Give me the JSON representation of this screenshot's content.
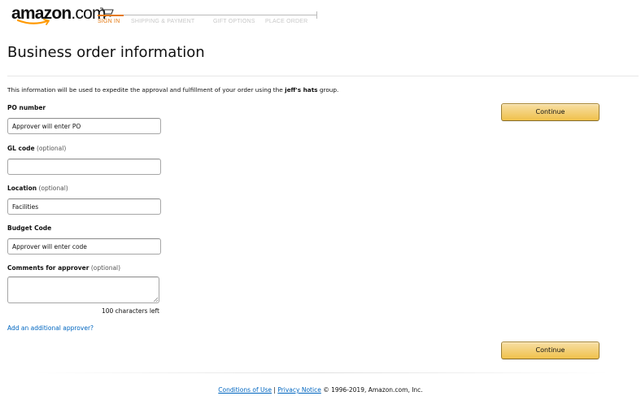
{
  "header": {
    "logo_main": "amazon",
    "logo_suffix": ".com",
    "steps": [
      "SIGN IN",
      "SHIPPING & PAYMENT",
      "GIFT OPTIONS",
      "PLACE ORDER"
    ],
    "active_step_index": 0,
    "cart_icon": "cart-icon"
  },
  "page": {
    "title": "Business order information",
    "intro_prefix": "This information will be used to expedite the approval and fulfillment of your order using the ",
    "intro_group": "jeff's hats",
    "intro_suffix": " group."
  },
  "form": {
    "po_number": {
      "label": "PO number",
      "optional": "",
      "value": "Approver will enter PO"
    },
    "gl_code": {
      "label": "GL code",
      "optional": " (optional)",
      "value": ""
    },
    "location": {
      "label": "Location",
      "optional": " (optional)",
      "value": "Facilities"
    },
    "budget_code": {
      "label": "Budget Code",
      "optional": "",
      "value": "Approver will enter code"
    },
    "comments": {
      "label": "Comments for approver",
      "optional": " (optional)",
      "value": "",
      "chars_left": "100 characters left"
    },
    "add_approver_link": "Add an additional approver?"
  },
  "buttons": {
    "continue_top": "Continue",
    "continue_bottom": "Continue"
  },
  "footer": {
    "conditions": "Conditions of Use",
    "separator": " | ",
    "privacy": "Privacy Notice",
    "copyright": " © 1996-2019, Amazon.com, Inc."
  },
  "colors": {
    "accent": "#e47911",
    "link": "#0066c0",
    "button_top": "#f7dfa5",
    "button_bottom": "#f0c14b"
  }
}
